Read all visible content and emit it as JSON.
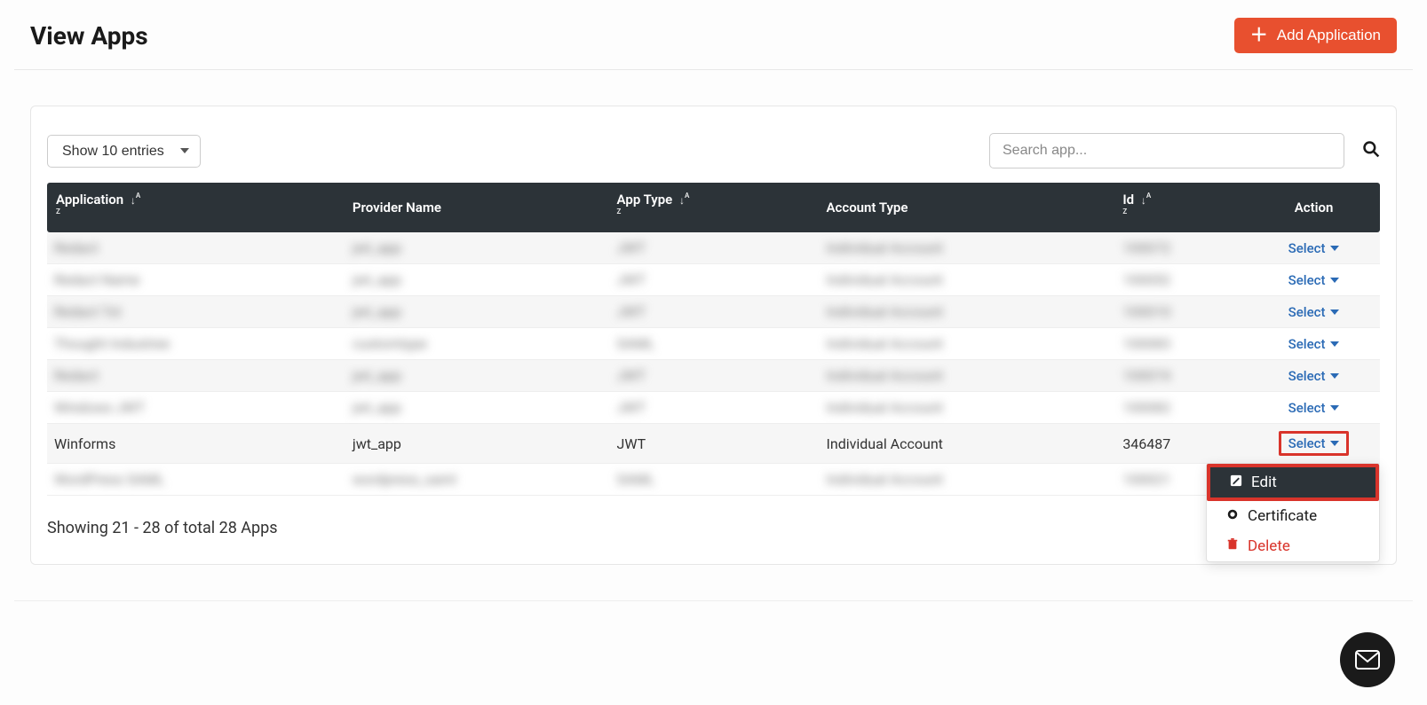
{
  "header": {
    "title": "View Apps",
    "add_button": "Add Application"
  },
  "controls": {
    "entries_label": "Show 10 entries",
    "search_placeholder": "Search app..."
  },
  "table": {
    "headers": {
      "application": "Application",
      "provider": "Provider Name",
      "app_type": "App Type",
      "account_type": "Account Type",
      "id": "Id",
      "action": "Action"
    },
    "action_label": "Select",
    "rows": [
      {
        "app": "Redact",
        "provider": "jwt_app",
        "type": "JWT",
        "acct": "Individual Account",
        "id": "100072",
        "blurred": true
      },
      {
        "app": "Redact Name",
        "provider": "jwt_app",
        "type": "JWT",
        "acct": "Individual Account",
        "id": "100052",
        "blurred": true
      },
      {
        "app": "Redact Txt",
        "provider": "jwt_app",
        "type": "JWT",
        "acct": "Individual Account",
        "id": "100010",
        "blurred": true
      },
      {
        "app": "Thought Industree",
        "provider": "customtype",
        "type": "SAML",
        "acct": "Individual Account",
        "id": "100083",
        "blurred": true
      },
      {
        "app": "Redact",
        "provider": "jwt_app",
        "type": "JWT",
        "acct": "Individual Account",
        "id": "100074",
        "blurred": true
      },
      {
        "app": "Windows JWT",
        "provider": "jwt_app",
        "type": "JWT",
        "acct": "Individual Account",
        "id": "100082",
        "blurred": true
      },
      {
        "app": "Winforms",
        "provider": "jwt_app",
        "type": "JWT",
        "acct": "Individual Account",
        "id": "346487",
        "blurred": false,
        "dropdown_open": true
      },
      {
        "app": "WordPress SAML",
        "provider": "wordpress_saml",
        "type": "SAML",
        "acct": "Individual Account",
        "id": "100021",
        "blurred": true
      }
    ]
  },
  "dropdown": {
    "edit": "Edit",
    "certificate": "Certificate",
    "delete": "Delete"
  },
  "footer": {
    "summary": "Showing 21 - 28 of total 28 Apps"
  }
}
